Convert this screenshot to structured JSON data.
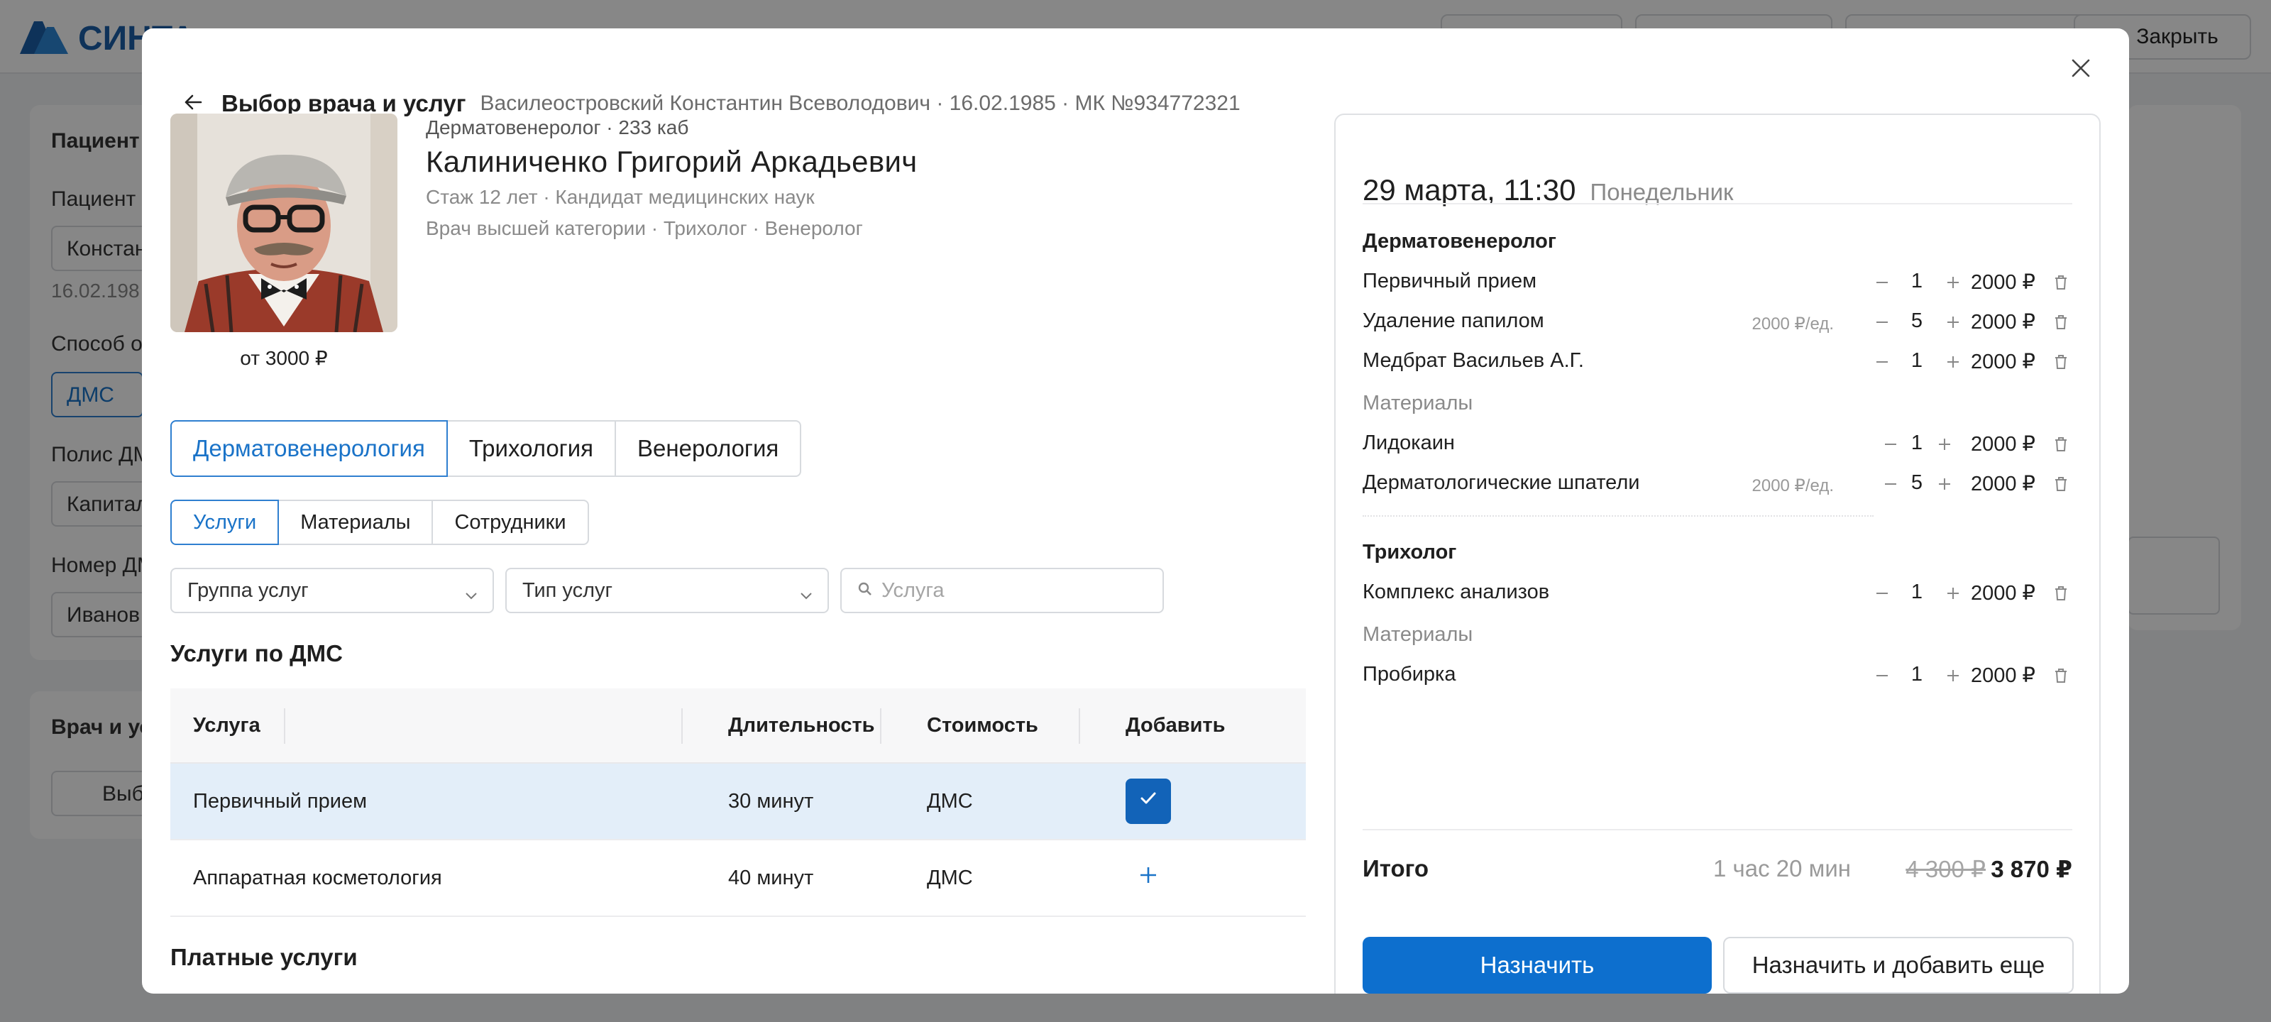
{
  "background": {
    "logo_text": "СИНТА",
    "close_label": "Закрыть",
    "patient_card_title": "Пациент",
    "patient_label": "Пациент",
    "patient_value": "Констан",
    "patient_dob": "16.02.198",
    "payment_label": "Способ о",
    "payment_value": "ДМС",
    "policy_label": "Полис ДМ",
    "policy_value": "Капитал",
    "number_label": "Номер ДМ",
    "number_value": "Иванов",
    "doctor_card_title": "Врач и ус",
    "doctor_button_label": "Выб"
  },
  "modal": {
    "title": "Выбор врача и услуг",
    "subtitle": "Василеостровский Константин Всеволодович · 16.02.1985 · МК №934772321"
  },
  "doctor": {
    "specialty": "Дерматовенеролог · 233 каб",
    "name": "Калиниченко Григорий Аркадьевич",
    "line1": "Стаж 12 лет · Кандидат медицинских наук",
    "line2": "Врач высшей категории · Трихолог · Венеролог",
    "price_from": "от 3000 ₽"
  },
  "spec_tabs": [
    "Дерматовенерология",
    "Трихология",
    "Венерология"
  ],
  "sub_tabs": [
    "Услуги",
    "Материалы",
    "Сотрудники"
  ],
  "filters": {
    "group": "Группа услуг",
    "type": "Тип услуг",
    "search_placeholder": "Услуга"
  },
  "sections": {
    "dms": "Услуги по ДМС",
    "paid": "Платные услуги"
  },
  "table": {
    "headers": [
      "Услуга",
      "Длительность",
      "Стоимость",
      "Добавить"
    ],
    "rows": [
      {
        "service": "Первичный прием",
        "duration": "30 минут",
        "cost": "ДМС",
        "added": true
      },
      {
        "service": "Аппаратная косметология",
        "duration": "40 минут",
        "cost": "ДМС",
        "added": false
      }
    ]
  },
  "summary": {
    "date": "29 марта, 11:30",
    "weekday": "Понедельник",
    "group1_title": "Дерматовенеролог",
    "group1_items": [
      {
        "name": "Первичный прием",
        "unit": "",
        "qty": "1",
        "price": "2000 ₽"
      },
      {
        "name": "Удаление папилом",
        "unit": "2000 ₽/ед.",
        "qty": "5",
        "price": "2000 ₽"
      },
      {
        "name": "Медбрат Васильев А.Г.",
        "unit": "",
        "qty": "1",
        "price": "2000 ₽"
      }
    ],
    "group1_materials_label": "Материалы",
    "group1_materials": [
      {
        "name": "Лидокаин",
        "unit": "",
        "qty": "1",
        "price": "2000 ₽"
      },
      {
        "name": "Дерматологические шпатели",
        "unit": "2000 ₽/ед.",
        "qty": "5",
        "price": "2000 ₽"
      }
    ],
    "group2_title": "Трихолог",
    "group2_items": [
      {
        "name": "Комплекс анализов",
        "unit": "",
        "qty": "1",
        "price": "2000 ₽"
      }
    ],
    "group2_materials_label": "Материалы",
    "group2_materials": [
      {
        "name": "Пробирка",
        "unit": "",
        "qty": "1",
        "price": "2000 ₽"
      }
    ],
    "total_label": "Итого",
    "total_time": "1 час 20 мин",
    "total_old": "4 300 ₽",
    "total_new": "3 870 ₽",
    "assign_label": "Назначить",
    "assign_more_label": "Назначить и добавить еще"
  },
  "colors": {
    "accent": "#1a73c8",
    "primary_button": "#0d6fce",
    "selected_row": "#e3eef9",
    "checkbox": "#1263b8"
  }
}
